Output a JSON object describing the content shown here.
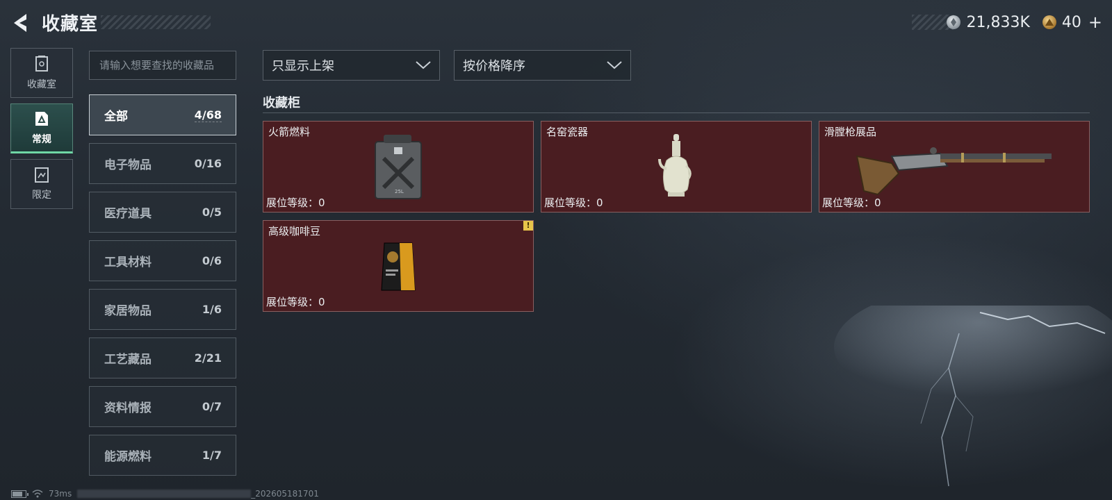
{
  "header": {
    "title": "收藏室",
    "currencies": [
      {
        "icon": "silver-coin-icon",
        "value": "21,833K"
      },
      {
        "icon": "gold-coin-icon",
        "value": "40"
      }
    ],
    "plus_label": "+"
  },
  "side_nav": {
    "items": [
      {
        "label": "收藏室",
        "icon": "collection-room-icon",
        "active": false
      },
      {
        "label": "常规",
        "icon": "regular-icon",
        "active": true
      },
      {
        "label": "限定",
        "icon": "limited-icon",
        "active": false
      }
    ]
  },
  "search": {
    "placeholder": "请输入想要查找的收藏品",
    "value": ""
  },
  "categories": [
    {
      "name": "全部",
      "count": "4/68",
      "active": true
    },
    {
      "name": "电子物品",
      "count": "0/16"
    },
    {
      "name": "医疗道具",
      "count": "0/5"
    },
    {
      "name": "工具材料",
      "count": "0/6"
    },
    {
      "name": "家居物品",
      "count": "1/6"
    },
    {
      "name": "工艺藏品",
      "count": "2/21"
    },
    {
      "name": "资料情报",
      "count": "0/7"
    },
    {
      "name": "能源燃料",
      "count": "1/7"
    }
  ],
  "filters": {
    "display_filter": "只显示上架",
    "sort_order": "按价格降序"
  },
  "cabinet": {
    "title": "收藏柜",
    "items": [
      {
        "name": "火箭燃料",
        "level": "展位等级：0",
        "image": "fuel-canister-image",
        "warning": false
      },
      {
        "name": "名窑瓷器",
        "level": "展位等级：0",
        "image": "porcelain-ewer-image",
        "warning": false
      },
      {
        "name": "滑膛枪展品",
        "level": "展位等级：0",
        "image": "musket-image",
        "warning": false
      },
      {
        "name": "高级咖啡豆",
        "level": "展位等级：0",
        "image": "coffee-bag-image",
        "warning": true,
        "warning_label": "!"
      }
    ]
  },
  "status_bar": {
    "ping": "73ms",
    "build": "_202605181701"
  },
  "colors": {
    "accent": "#6fd6a5",
    "card_bg": "#4a1d21",
    "warning": "#e7c44a"
  }
}
